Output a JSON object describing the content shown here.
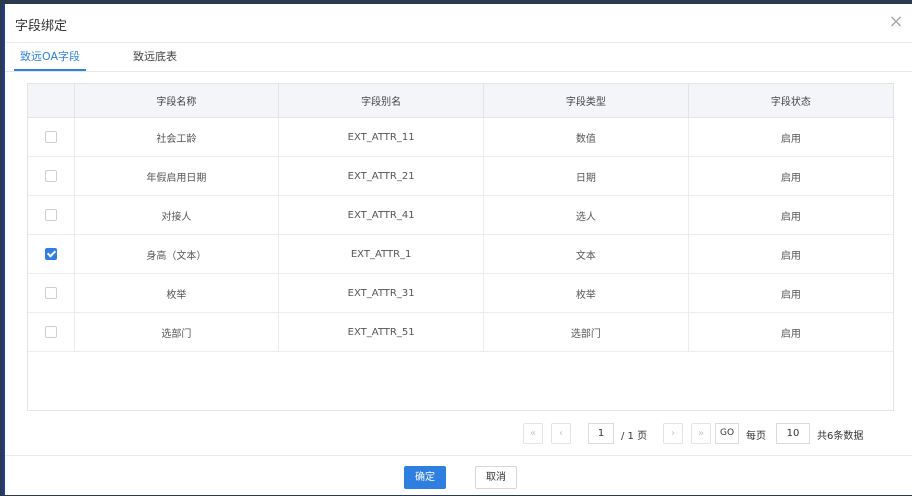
{
  "dialog": {
    "title": "字段绑定",
    "close_symbol": "×"
  },
  "tabs": [
    {
      "label": "致远OA字段",
      "active": true
    },
    {
      "label": "致远底表",
      "active": false
    }
  ],
  "table": {
    "headers": [
      "字段名称",
      "字段别名",
      "字段类型",
      "字段状态"
    ],
    "rows": [
      {
        "checked": false,
        "name": "社会工龄",
        "alias": "EXT_ATTR_11",
        "type": "数值",
        "status": "启用"
      },
      {
        "checked": false,
        "name": "年假启用日期",
        "alias": "EXT_ATTR_21",
        "type": "日期",
        "status": "启用"
      },
      {
        "checked": false,
        "name": "对接人",
        "alias": "EXT_ATTR_41",
        "type": "选人",
        "status": "启用"
      },
      {
        "checked": true,
        "name": "身高（文本）",
        "alias": "EXT_ATTR_1",
        "type": "文本",
        "status": "启用"
      },
      {
        "checked": false,
        "name": "枚举",
        "alias": "EXT_ATTR_31",
        "type": "枚举",
        "status": "启用"
      },
      {
        "checked": false,
        "name": "选部门",
        "alias": "EXT_ATTR_51",
        "type": "选部门",
        "status": "启用"
      }
    ]
  },
  "pager": {
    "first_symbol": "«",
    "prev_symbol": "‹",
    "current_page": "1",
    "total_pages_text": "/ 1 页",
    "next_symbol": "›",
    "last_symbol": "»",
    "go_label": "GO",
    "per_page_label": "每页",
    "per_page_value": "10",
    "total_text": "共6条数据"
  },
  "footer": {
    "confirm_label": "确定",
    "cancel_label": "取消"
  },
  "colors": {
    "accent": "#2f7fe0",
    "header_bg": "#f3f5f8"
  }
}
